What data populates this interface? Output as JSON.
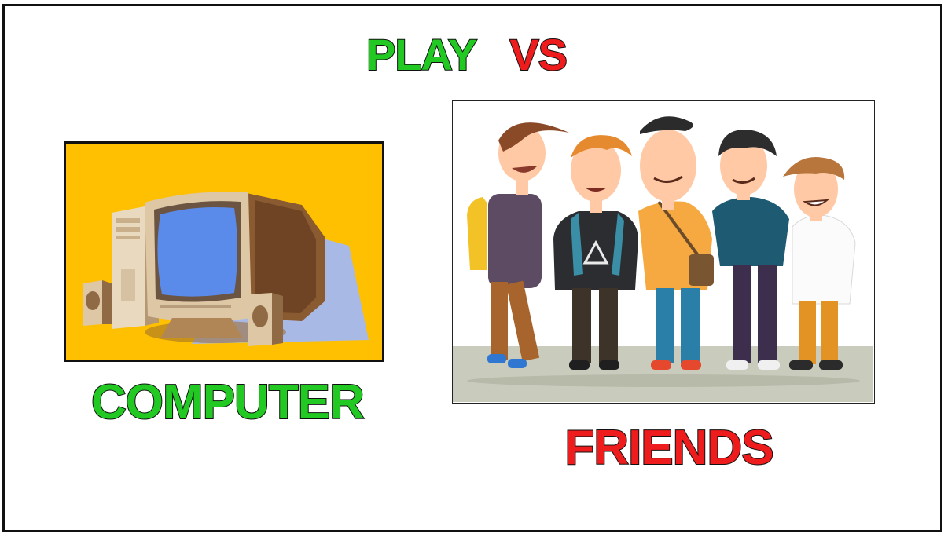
{
  "title": {
    "word1": "PLAY",
    "word2": "VS"
  },
  "options": {
    "computer_label": "COMPUTER",
    "friends_label": "FRIENDS"
  },
  "colors": {
    "green": "#22c922",
    "red": "#ee1c1c",
    "computer_bg": "#fec000",
    "screen": "#5b8bea",
    "ground": "#c9ccbd"
  },
  "icons": {
    "computer_image": "desktop-computer-illustration",
    "friends_image": "group-of-friends-illustration"
  }
}
